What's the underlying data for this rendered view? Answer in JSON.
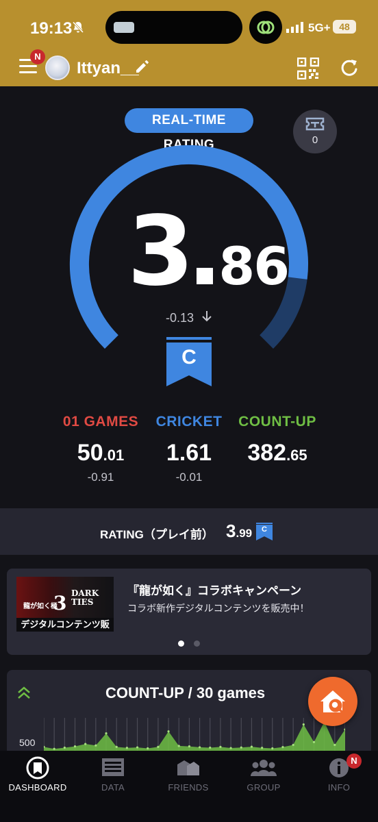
{
  "status_bar": {
    "time": "19:13",
    "network": "5G+",
    "battery": "48"
  },
  "header": {
    "username": "Ittyan__",
    "menu_badge": "N"
  },
  "rating": {
    "label": "REAL-TIME RATING",
    "value_int": "3",
    "value_dec": "86",
    "delta": "-0.13",
    "rank": "C",
    "gauge_level": 0.86,
    "ticket_count": "0"
  },
  "stats": [
    {
      "label": "01 GAMES",
      "value_int": "50",
      "value_dec": ".01",
      "delta": "-0.91",
      "color": "#e04a43"
    },
    {
      "label": "CRICKET",
      "value_int": "1.61",
      "value_dec": "",
      "delta": "-0.01",
      "color": "#3f86e0"
    },
    {
      "label": "COUNT-UP",
      "value_int": "382",
      "value_dec": ".65",
      "delta": "",
      "color": "#6fbe44"
    }
  ],
  "previous_rating": {
    "label": "RATING（プレイ前）",
    "value_int": "3",
    "value_dec": ".99",
    "rank": "C"
  },
  "campaign": {
    "title": "『龍が如く』コラボキャンペーン",
    "subtitle": "コラボ新作デジタルコンテンツを販売中！",
    "banner_text": "デジタルコンテンツ販売",
    "banner_title": "龍が如く極",
    "banner_number": "3",
    "banner_dark": "DARK TIES",
    "slide_count": 2,
    "active_slide": 0
  },
  "countup_chart": {
    "title": "COUNT-UP / 30 games",
    "y_tick": "500"
  },
  "chart_data": {
    "type": "area",
    "title": "COUNT-UP / 30 games",
    "y_ticks": [
      "500"
    ],
    "series": [
      {
        "values": [
          380,
          360,
          372,
          385,
          410,
          395,
          520,
          380,
          370,
          375,
          365,
          380,
          540,
          390,
          385,
          376,
          372,
          380,
          368,
          374,
          382,
          370,
          365,
          378,
          400,
          612,
          430,
          640,
          400,
          560
        ]
      }
    ]
  },
  "tabs": [
    {
      "label": "DASHBOARD",
      "icon": "dashboard-icon",
      "active": true
    },
    {
      "label": "DATA",
      "icon": "data-icon",
      "active": false
    },
    {
      "label": "FRIENDS",
      "icon": "friends-icon",
      "active": false
    },
    {
      "label": "GROUP",
      "icon": "group-icon",
      "active": false
    },
    {
      "label": "INFO",
      "icon": "info-icon",
      "active": false,
      "badge": "N"
    }
  ],
  "colors": {
    "header_bg": "#b8902e",
    "accent_blue": "#3f86e0",
    "gauge_track": "#1f3c66",
    "fab_orange": "#ef6a2d",
    "chart_green": "#6fbe44"
  }
}
